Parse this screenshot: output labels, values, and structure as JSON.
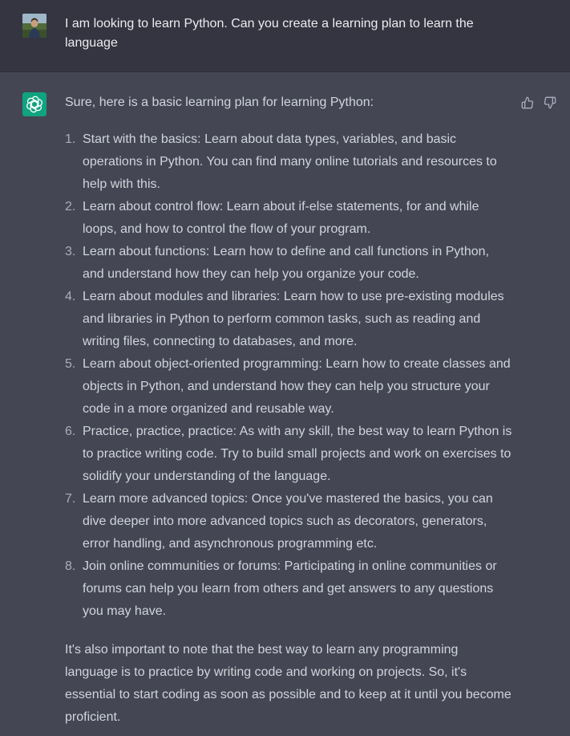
{
  "user": {
    "avatar_icon": "user-photo-avatar",
    "message": "I am looking to learn Python. Can you create a learning plan to learn the language"
  },
  "assistant": {
    "avatar_icon": "openai-logo-icon",
    "brand_color": "#10a37f",
    "intro": "Sure, here is a basic learning plan for learning Python:",
    "items": [
      {
        "num": "1.",
        "text": "Start with the basics: Learn about data types, variables, and basic operations in Python. You can find many online tutorials and resources to help with this."
      },
      {
        "num": "2.",
        "text": "Learn about control flow: Learn about if-else statements, for and while loops, and how to control the flow of your program."
      },
      {
        "num": "3.",
        "text": "Learn about functions: Learn how to define and call functions in Python, and understand how they can help you organize your code."
      },
      {
        "num": "4.",
        "text": "Learn about modules and libraries: Learn how to use pre-existing modules and libraries in Python to perform common tasks, such as reading and writing files, connecting to databases, and more."
      },
      {
        "num": "5.",
        "text": "Learn about object-oriented programming: Learn how to create classes and objects in Python, and understand how they can help you structure your code in a more organized and reusable way."
      },
      {
        "num": "6.",
        "text": "Practice, practice, practice: As with any skill, the best way to learn Python is to practice writing code. Try to build small projects and work on exercises to solidify your understanding of the language."
      },
      {
        "num": "7.",
        "text": "Learn more advanced topics: Once you've mastered the basics, you can dive deeper into more advanced topics such as decorators, generators, error handling, and asynchronous programming etc."
      },
      {
        "num": "8.",
        "text": "Join online communities or forums: Participating in online communities or forums can help you learn from others and get answers to any questions you may have."
      }
    ],
    "closing": "It's also important to note that the best way to learn any programming language is to practice by writing code and working on projects. So, it's essential to start coding as soon as possible and to keep at it until you become proficient."
  },
  "feedback": {
    "thumbs_up_icon": "thumbs-up-icon",
    "thumbs_down_icon": "thumbs-down-icon"
  }
}
